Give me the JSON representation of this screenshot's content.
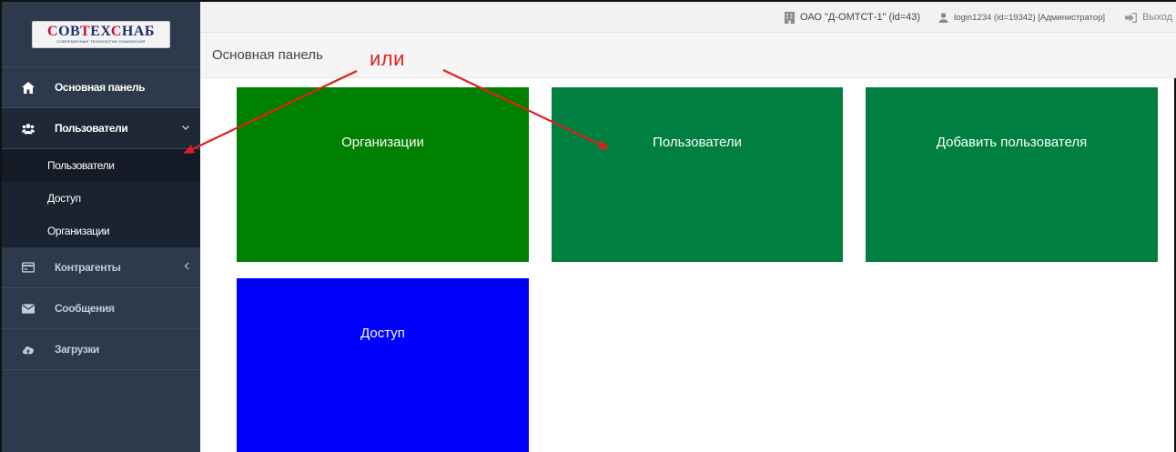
{
  "logo": {
    "main_a": "С",
    "main_b": "ОВ",
    "main_c": "Т",
    "main_d": "ЕХ",
    "main_e": "С",
    "main_f": "НАБ",
    "sub": "современные технологии снабжения"
  },
  "topbar": {
    "org": "ОАО \"Д-ОМТСТ-1\" (id=43)",
    "user": "login1234 (id=19342) [Администратор]",
    "exit": "Выход",
    "icons": {
      "org": "building-icon",
      "user": "user-icon",
      "exit": "logout-icon"
    }
  },
  "header": {
    "title": "Основная панель"
  },
  "sidebar": {
    "items": [
      {
        "label": "Основная панель",
        "icon": "home-icon"
      },
      {
        "label": "Пользователи",
        "icon": "users-icon",
        "expanded": true
      },
      {
        "label": "Контрагенты",
        "icon": "card-icon"
      },
      {
        "label": "Сообщения",
        "icon": "envelope-icon"
      },
      {
        "label": "Загрузки",
        "icon": "cloud-upload-icon"
      }
    ],
    "subitems": [
      {
        "label": "Пользователи",
        "active": true
      },
      {
        "label": "Доступ"
      },
      {
        "label": "Организации"
      }
    ]
  },
  "tiles": [
    {
      "label": "Организации",
      "color": "#008000"
    },
    {
      "label": "Пользователи",
      "color": "#008040"
    },
    {
      "label": "Добавить пользователя",
      "color": "#008040"
    },
    {
      "label": "Доступ",
      "color": "#0000ff"
    }
  ],
  "annotation": {
    "label": "или",
    "color": "#e02020"
  }
}
